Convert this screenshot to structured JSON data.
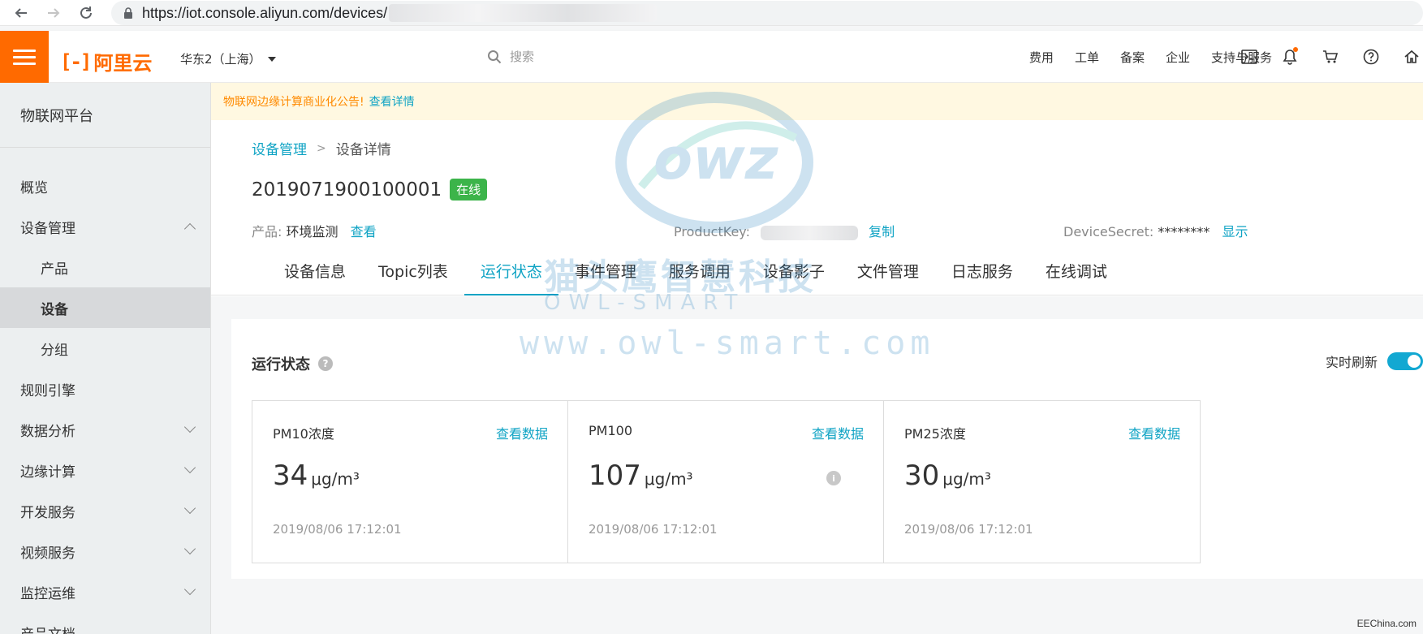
{
  "browser": {
    "url": "https://iot.console.aliyun.com/devices/"
  },
  "topnav": {
    "logo_text": "阿里云",
    "region": "华东2（上海）",
    "search_placeholder": "搜索",
    "links": [
      "费用",
      "工单",
      "备案",
      "企业",
      "支持与服务"
    ],
    "brand_color": "#ff6a00"
  },
  "sidebar": {
    "title": "物联网平台",
    "items": [
      {
        "label": "概览"
      },
      {
        "label": "设备管理"
      },
      {
        "label": "产品"
      },
      {
        "label": "设备"
      },
      {
        "label": "分组"
      },
      {
        "label": "规则引擎"
      },
      {
        "label": "数据分析"
      },
      {
        "label": "边缘计算"
      },
      {
        "label": "开发服务"
      },
      {
        "label": "视频服务"
      },
      {
        "label": "监控运维"
      },
      {
        "label": "产品文档"
      }
    ]
  },
  "notice": {
    "text": "物联网边缘计算商业化公告!",
    "link": "查看详情"
  },
  "breadcrumb": {
    "parent": "设备管理",
    "current": "设备详情"
  },
  "device": {
    "name": "2019071900100001",
    "status": "在线",
    "product_label": "产品:",
    "product_value": "环境监测",
    "product_link": "查看",
    "productkey_label": "ProductKey:",
    "productkey_action": "复制",
    "devicesecret_label": "DeviceSecret:",
    "devicesecret_value": "********",
    "devicesecret_action": "显示"
  },
  "tabs": [
    {
      "label": "设备信息"
    },
    {
      "label": "Topic列表"
    },
    {
      "label": "运行状态"
    },
    {
      "label": "事件管理"
    },
    {
      "label": "服务调用"
    },
    {
      "label": "设备影子"
    },
    {
      "label": "文件管理"
    },
    {
      "label": "日志服务"
    },
    {
      "label": "在线调试"
    }
  ],
  "panel": {
    "title": "运行状态",
    "refresh_label": "实时刷新",
    "refresh_on": true,
    "view_data_label": "查看数据",
    "cards": [
      {
        "name": "PM10浓度",
        "value": "34",
        "unit": "μg/m³",
        "time": "2019/08/06 17:12:01"
      },
      {
        "name": "PM100",
        "value": "107",
        "unit": "μg/m³",
        "time": "2019/08/06 17:12:01"
      },
      {
        "name": "PM25浓度",
        "value": "30",
        "unit": "μg/m³",
        "time": "2019/08/06 17:12:01"
      }
    ]
  },
  "watermark": {
    "cn": "猫头鹰智慧科技",
    "en": "OWL-SMART",
    "site": "www.owl-smart.com"
  },
  "corner_mark": "EEChina.com"
}
